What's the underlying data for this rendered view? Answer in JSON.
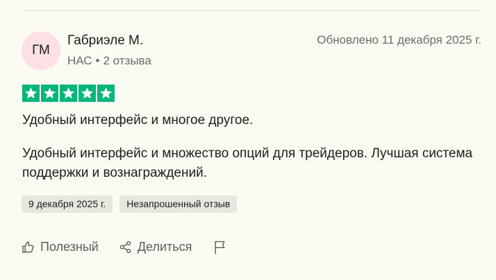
{
  "reviewer": {
    "initials": "ГМ",
    "name": "Габриэле М.",
    "country": "НАС",
    "reviews_count": "2 отзыва",
    "avatar_color": "#fde0e6"
  },
  "review": {
    "updated": "Обновлено 11 декабря 2025 г.",
    "rating": 5,
    "max_rating": 5,
    "star_color": "#00b67a",
    "title": "Удобный интерфейс и многое другое.",
    "text": "Удобный интерфейс и множество опций для трейдеров. Лучшая система поддержки и вознаграждений.",
    "date_tag": "9 декабря 2025 г.",
    "type_tag": "Незапрошенный отзыв"
  },
  "actions": {
    "useful_label": "Полезный",
    "useful_icon": "thumbs-up-icon",
    "share_label": "Делиться",
    "share_icon": "share-icon",
    "report_icon": "flag-icon"
  }
}
